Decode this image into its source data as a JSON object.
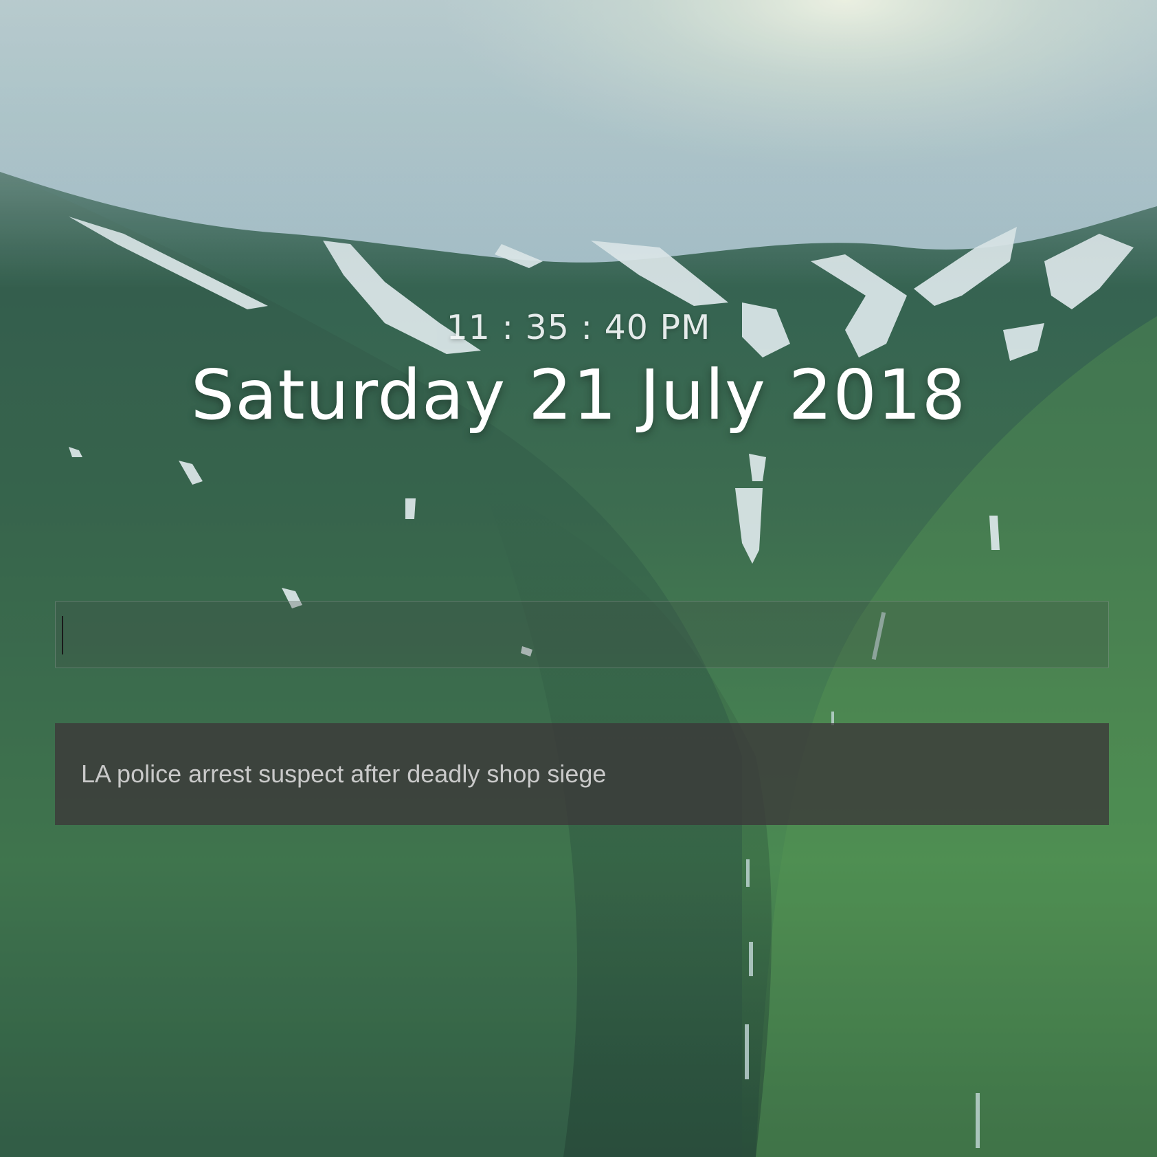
{
  "clock": {
    "time": "11 : 35 : 40 PM"
  },
  "date": {
    "full": "Saturday 21 July 2018"
  },
  "search": {
    "value": "",
    "placeholder": ""
  },
  "news": {
    "headline": "LA police arrest suspect after deadly shop siege"
  },
  "colors": {
    "sky": "#a9c3cc",
    "mountain_green": "#3f7a4a",
    "snow": "#e8eef0",
    "news_panel": "#3c373a"
  }
}
